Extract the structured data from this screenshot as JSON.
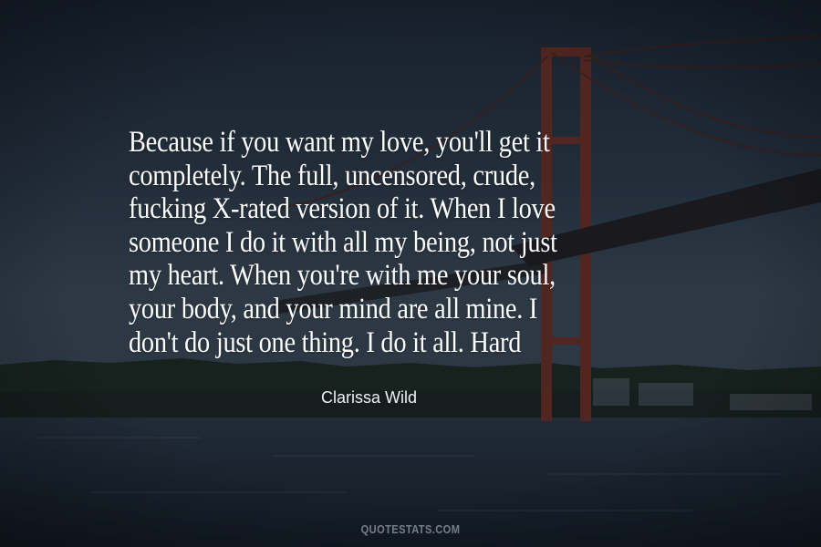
{
  "quote": {
    "lines": [
      "Because if you want my love, you'll get it",
      "completely. The full, uncensored, crude,",
      "fucking X-rated version of it. When I love",
      "someone I do it with all my being, not just",
      "my heart. When you're with me your soul,",
      "your body, and your mind are all mine. I",
      "don't do just one thing. I do it all. Hard"
    ],
    "color": "#ffffff"
  },
  "author": {
    "name": "Clarissa Wild"
  },
  "watermark": {
    "text": "QUOTESTATS.COM"
  },
  "background": {
    "description_icon": "bridge-at-dusk-photo",
    "sky_color": "#2b3a4a",
    "water_color": "#1f2a36",
    "bridge_color": "#7a3326"
  }
}
